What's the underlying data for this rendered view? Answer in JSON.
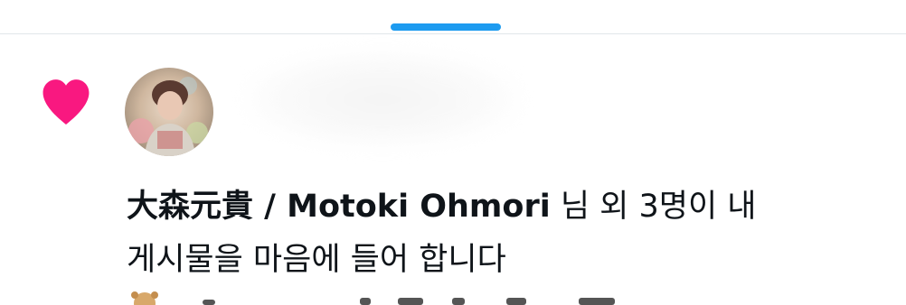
{
  "notification": {
    "actor_name": "大森元貴 / Motoki Ohmori",
    "message": " 님 외 3명이 내\n게시물을 마음에 들어 합니다",
    "icon": "heart-icon"
  },
  "colors": {
    "accent": "#1d9bf0",
    "like": "#f91880",
    "text": "#0f1419",
    "divider": "#e1e6ea"
  }
}
